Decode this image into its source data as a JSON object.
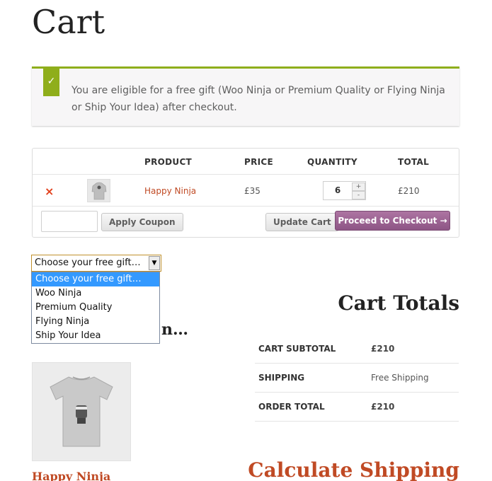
{
  "page": {
    "title": "Cart"
  },
  "notice": {
    "icon": "check-icon",
    "text": "You are eligible for a free gift (Woo Ninja or Premium Quality or Flying Ninja or Ship Your Idea) after checkout.",
    "accent_color": "#8fae1b"
  },
  "cart": {
    "headers": {
      "product": "PRODUCT",
      "price": "PRICE",
      "quantity": "QUANTITY",
      "total": "TOTAL"
    },
    "items": [
      {
        "remove": "×",
        "name": "Happy Ninja",
        "price": "£35",
        "quantity": "6",
        "total": "£210"
      }
    ],
    "coupon_placeholder": "",
    "apply_coupon_label": "Apply Coupon",
    "update_cart_label": "Update Cart",
    "checkout_label": "Proceed to Checkout →"
  },
  "gift": {
    "selected": "Choose your free gift…",
    "options": [
      "Choose your free gift…",
      "Woo Ninja",
      "Premium Quality",
      "Flying Ninja",
      "Ship Your Idea"
    ]
  },
  "cross_sells": {
    "heading_visible_fragment": "n…",
    "products": [
      {
        "name": "Happy Ninja"
      }
    ]
  },
  "totals": {
    "heading": "Cart Totals",
    "rows": [
      {
        "label": "CART SUBTOTAL",
        "value": "£210"
      },
      {
        "label": "SHIPPING",
        "value": "Free Shipping"
      },
      {
        "label": "ORDER TOTAL",
        "value": "£210"
      }
    ]
  },
  "shipping": {
    "heading": "Calculate Shipping"
  },
  "colors": {
    "link": "#c04a24",
    "checkout_button": "#9b6594",
    "dropdown_highlight": "#3399ff"
  }
}
